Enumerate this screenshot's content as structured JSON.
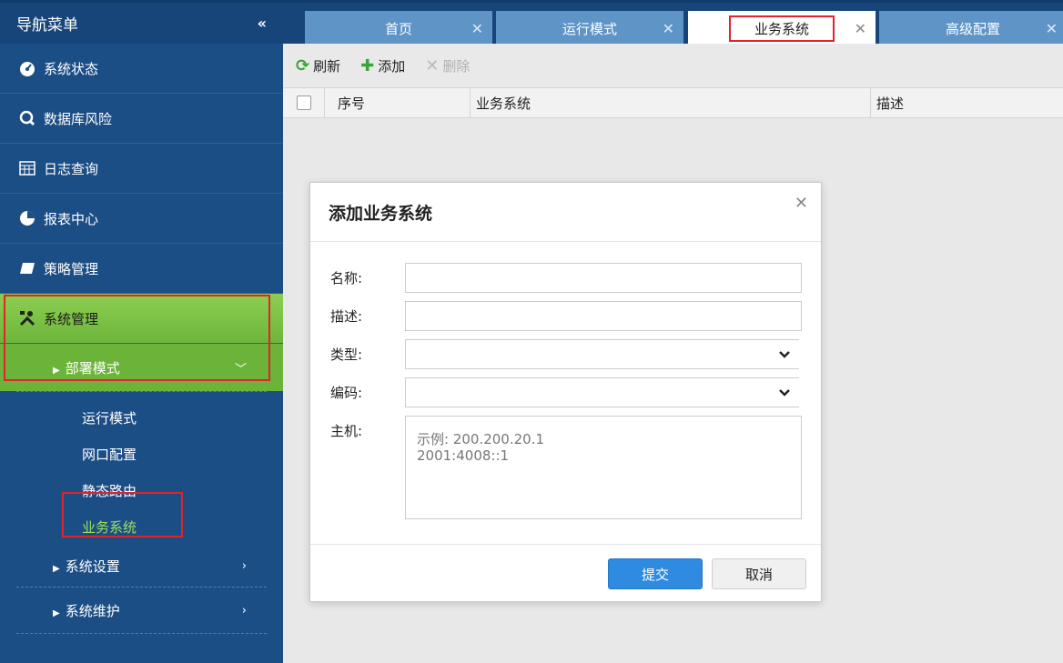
{
  "sidebar": {
    "title": "导航菜单",
    "collapse_icon": "«",
    "items": [
      {
        "label": "系统状态",
        "icon": "dashboard-icon"
      },
      {
        "label": "数据库风险",
        "icon": "search-icon"
      },
      {
        "label": "日志查询",
        "icon": "table-icon"
      },
      {
        "label": "报表中心",
        "icon": "pie-chart-icon"
      },
      {
        "label": "策略管理",
        "icon": "book-icon"
      },
      {
        "label": "系统管理",
        "icon": "tools-icon"
      }
    ],
    "subgroups": [
      {
        "label": "部署模式",
        "expanded": true
      },
      {
        "label": "系统设置",
        "expanded": false
      },
      {
        "label": "系统维护",
        "expanded": false
      }
    ],
    "leaves": [
      "运行模式",
      "网口配置",
      "静态路由",
      "业务系统"
    ]
  },
  "tabs": [
    "首页",
    "运行模式",
    "业务系统",
    "高级配置"
  ],
  "toolbar": {
    "refresh": "刷新",
    "add": "添加",
    "delete": "删除"
  },
  "grid": {
    "columns": [
      "序号",
      "业务系统",
      "描述"
    ]
  },
  "dialog": {
    "title": "添加业务系统",
    "fields": {
      "name_label": "名称:",
      "desc_label": "描述:",
      "type_label": "类型:",
      "code_label": "编码:",
      "host_label": "主机:",
      "host_placeholder": "示例: 200.200.20.1\n2001:4008::1"
    },
    "submit": "提交",
    "cancel": "取消"
  },
  "colors": {
    "sidebar": "#1c4e86",
    "active_green": "#6db63a",
    "primary": "#2e8be0",
    "highlight": "#e2232a"
  }
}
